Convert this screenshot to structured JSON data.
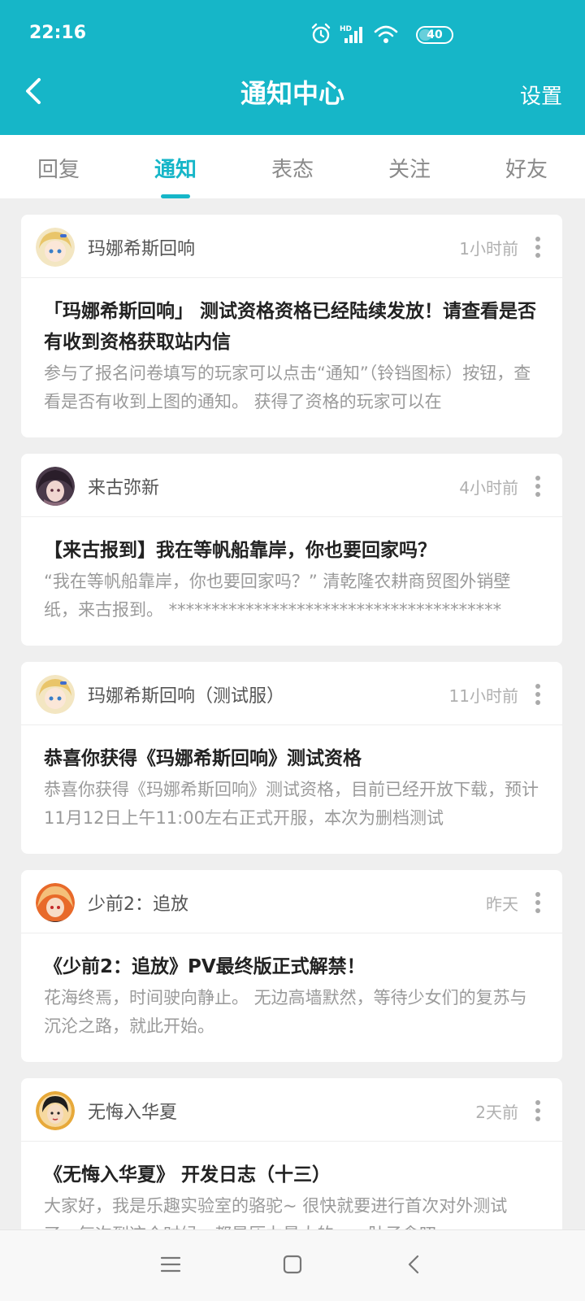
{
  "status_bar": {
    "time": "22:16",
    "icons": [
      "alarm-icon",
      "hd-signal-icon",
      "wifi-icon",
      "battery-icon"
    ],
    "battery_label": "40",
    "battery_level": 0.4
  },
  "header": {
    "title": "通知中心",
    "settings_label": "设置",
    "back_icon": "back-chevron-icon",
    "background_color": "#16b6c8"
  },
  "tabs": [
    {
      "label": "回复",
      "active": false
    },
    {
      "label": "通知",
      "active": true
    },
    {
      "label": "表态",
      "active": false
    },
    {
      "label": "关注",
      "active": false
    },
    {
      "label": "好友",
      "active": false
    }
  ],
  "notifications": [
    {
      "author": "玛娜希斯回响",
      "time": "1小时前",
      "title": "「玛娜希斯回响」 测试资格资格已经陆续发放！请查看是否有收到资格获取站内信",
      "summary": "参与了报名问卷填写的玩家可以点击“通知”（铃铛图标）按钮，查看是否有收到上图的通知。 获得了资格的玩家可以在"
    },
    {
      "author": "来古弥新",
      "time": "4小时前",
      "title": "【来古报到】我在等帆船靠岸，你也要回家吗？",
      "summary": "“我在等帆船靠岸，你也要回家吗？” 清乾隆农耕商贸图外销壁纸，来古报到。 ***************************************"
    },
    {
      "author": "玛娜希斯回响（测试服）",
      "time": "11小时前",
      "title": "恭喜你获得《玛娜希斯回响》测试资格",
      "summary": "恭喜你获得《玛娜希斯回响》测试资格，目前已经开放下载，预计11月12日上午11:00左右正式开服，本次为删档测试"
    },
    {
      "author": "少前2：追放",
      "time": "昨天",
      "title": "《少前2：追放》PV最终版正式解禁！",
      "summary": "花海终焉，时间驶向静止。 无边高墙默然，等待少女们的复苏与沉沦之路，就此开始。"
    },
    {
      "author": "无悔入华夏",
      "time": "2天前",
      "title": "《无悔入华夏》 开发日志（十三）",
      "summary": "大家好，我是乐趣实验室的骆驼~ 很快就要进行首次对外测试了，每次到这个时候，都是压力最大的，一肚子念叨"
    }
  ],
  "nav_bar": {
    "icons": [
      "menu-icon",
      "home-icon",
      "back-icon"
    ]
  }
}
